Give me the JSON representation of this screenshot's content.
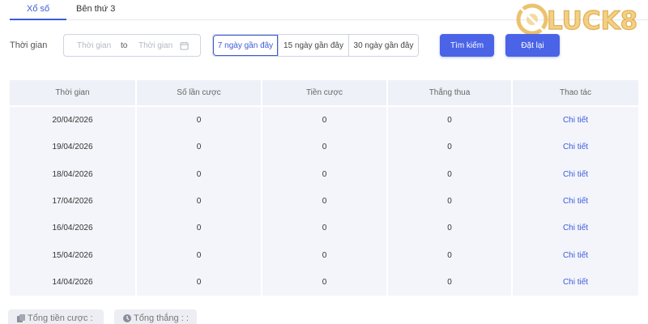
{
  "tabs": [
    {
      "label": "Xổ số",
      "active": true
    },
    {
      "label": "Bên thứ 3",
      "active": false
    }
  ],
  "logo": {
    "text": "LUCK8"
  },
  "filter": {
    "label": "Thời gian",
    "start_placeholder": "Thời gian",
    "separator": "to",
    "end_placeholder": "Thời gian",
    "quick_ranges": [
      "7 ngày gần đây",
      "15 ngày gần đây",
      "30 ngày gần đây"
    ],
    "search_label": "Tìm kiếm",
    "reset_label": "Đặt lại"
  },
  "table": {
    "headers": [
      "Thời gian",
      "Số lần cược",
      "Tiền cược",
      "Thắng thua",
      "Thao tác"
    ],
    "rows": [
      {
        "date": "20/04/2026",
        "bets": "0",
        "amount": "0",
        "winloss": "0",
        "action": "Chi tiết"
      },
      {
        "date": "19/04/2026",
        "bets": "0",
        "amount": "0",
        "winloss": "0",
        "action": "Chi tiết"
      },
      {
        "date": "18/04/2026",
        "bets": "0",
        "amount": "0",
        "winloss": "0",
        "action": "Chi tiết"
      },
      {
        "date": "17/04/2026",
        "bets": "0",
        "amount": "0",
        "winloss": "0",
        "action": "Chi tiết"
      },
      {
        "date": "16/04/2026",
        "bets": "0",
        "amount": "0",
        "winloss": "0",
        "action": "Chi tiết"
      },
      {
        "date": "15/04/2026",
        "bets": "0",
        "amount": "0",
        "winloss": "0",
        "action": "Chi tiết"
      },
      {
        "date": "14/04/2026",
        "bets": "0",
        "amount": "0",
        "winloss": "0",
        "action": "Chi tiết"
      }
    ]
  },
  "totals": {
    "bet_label": "Tổng tiền cược :",
    "win_label": "Tổng thắng : :"
  },
  "colors": {
    "accent": "#4a63e7",
    "link": "#3d5bd9",
    "logo_gold": "#e8b34a"
  },
  "icons": {
    "calendar": "calendar-icon",
    "coins": "coins-icon",
    "clock": "clock-icon"
  }
}
